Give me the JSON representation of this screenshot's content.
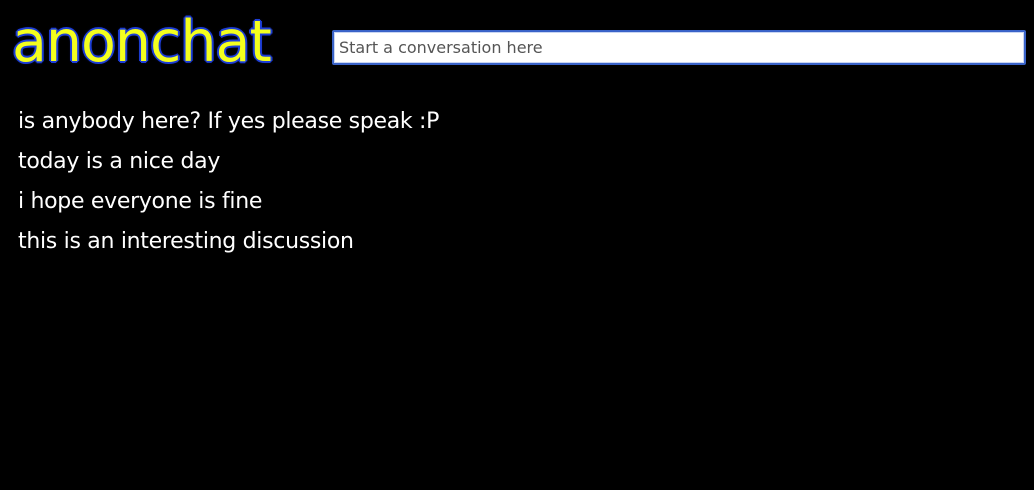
{
  "app": {
    "logo_text": "anonchat"
  },
  "search": {
    "placeholder": "Start a conversation here",
    "value": ""
  },
  "messages": [
    "is anybody here? If yes please speak :P",
    "today is a nice day",
    "i hope everyone is fine",
    "this is an interesting discussion"
  ],
  "colors": {
    "background": "#000000",
    "logo_fill": "#f4ff1e",
    "logo_outline": "#1f3fd6",
    "message_text": "#ffffff",
    "input_border": "#3a63c8"
  }
}
